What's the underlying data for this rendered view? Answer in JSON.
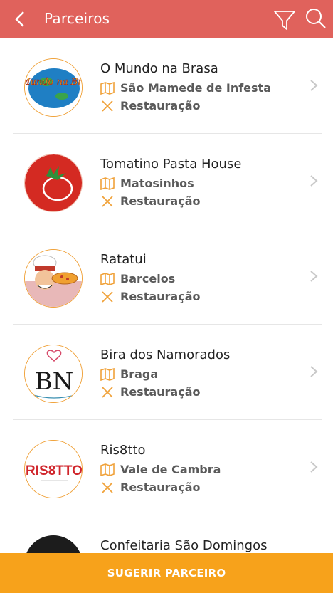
{
  "header": {
    "title": "Parceiros"
  },
  "partners": [
    {
      "name": "O Mundo na Brasa",
      "location": "São Mamede de Infesta",
      "category": "Restauração",
      "logo_text": "O Mundo na Brasa"
    },
    {
      "name": "Tomatino Pasta House",
      "location": "Matosinhos",
      "category": "Restauração"
    },
    {
      "name": "Ratatui",
      "location": "Barcelos",
      "category": "Restauração"
    },
    {
      "name": "Bira dos Namorados",
      "location": "Braga",
      "category": "Restauração",
      "logo_text": "BN"
    },
    {
      "name": "Ris8tto",
      "location": "Vale de Cambra",
      "category": "Restauração",
      "logo_text": "RIS8TTO"
    },
    {
      "name": "Confeitaria São Domingos"
    }
  ],
  "footer": {
    "button_label": "SUGERIR PARCEIRO"
  },
  "colors": {
    "header_bg": "#e0625c",
    "accent": "#f7a21b",
    "icon": "#f0a23a"
  },
  "icons": [
    "back-arrow-icon",
    "filter-icon",
    "search-icon",
    "map-icon",
    "cutlery-icon",
    "chevron-right-icon"
  ]
}
